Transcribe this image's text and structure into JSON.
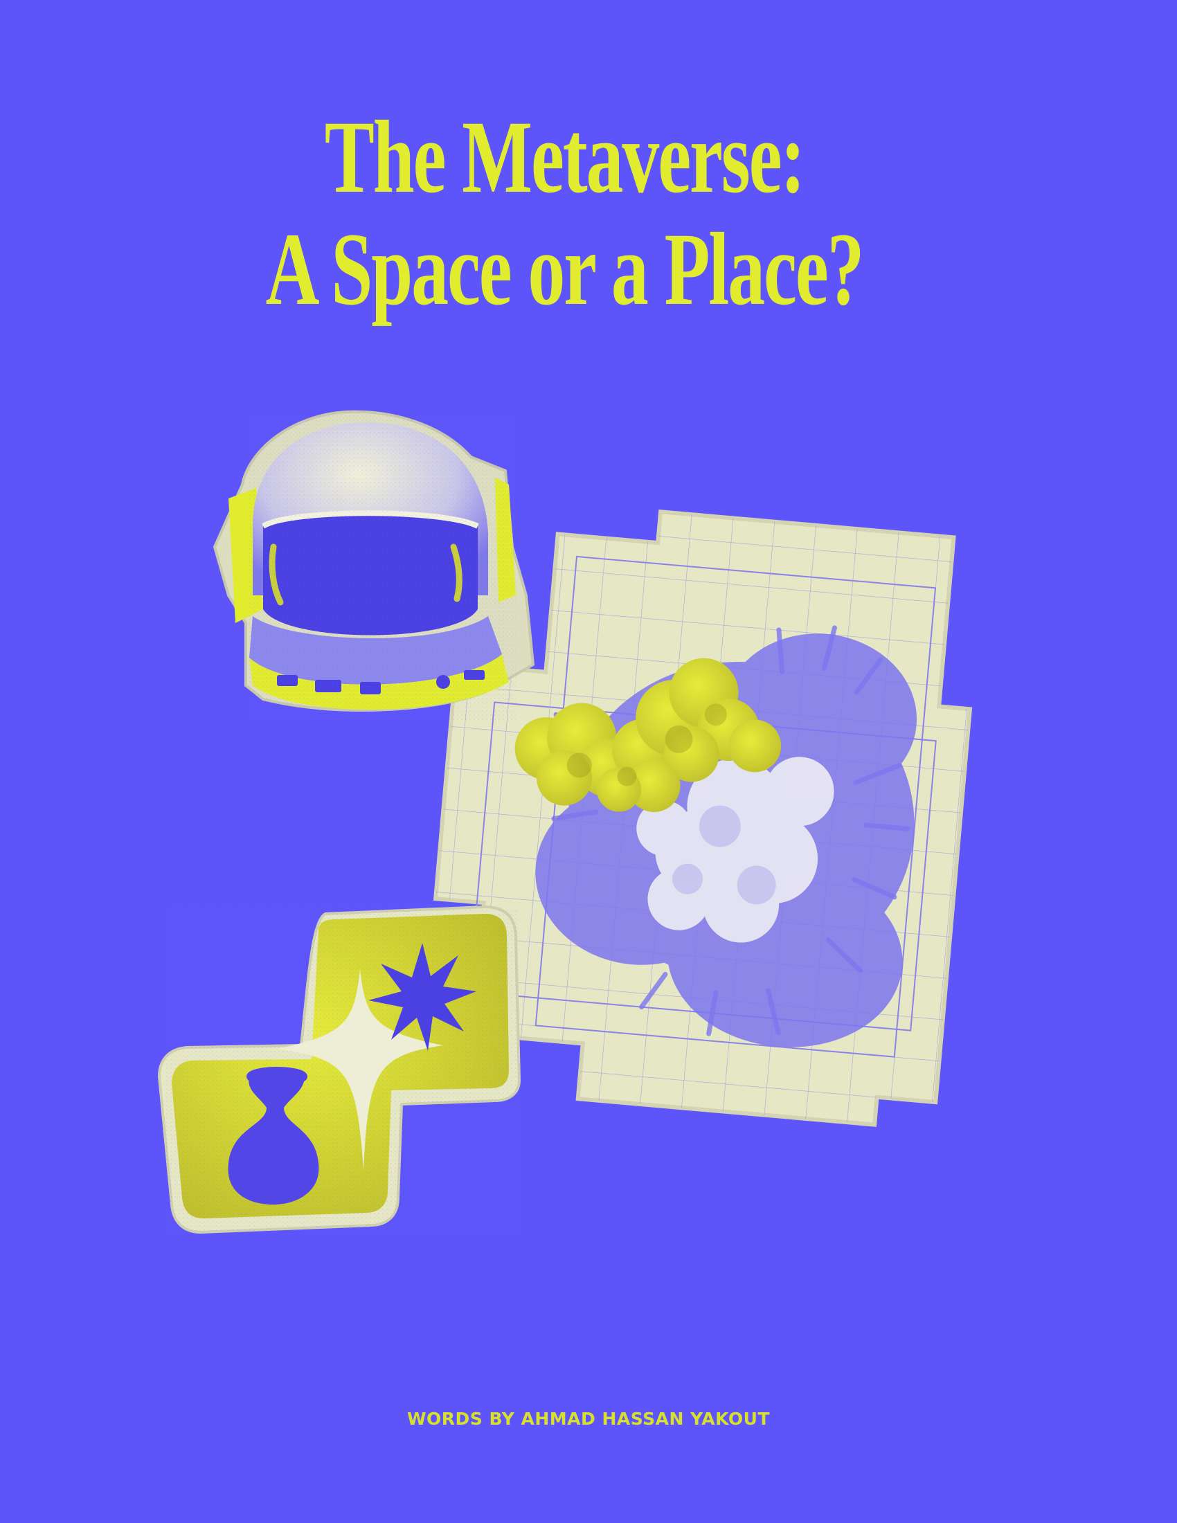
{
  "article": {
    "title_line1": "The Metaverse:",
    "title_line2": "A Space or a Place?",
    "byline": "WORDS BY AHMAD HASSAN YAKOUT"
  },
  "colors": {
    "background": "#5d55fa",
    "accent_yellow": "#e2ec2e",
    "cream": "#e6e7c4",
    "deep_blue": "#4a3fe0"
  },
  "icons": {
    "sticker_1": "astronaut-helmet-icon",
    "sticker_2": "grid-map-cloud-icon",
    "sticker_3": "sparkle-vase-icon"
  }
}
